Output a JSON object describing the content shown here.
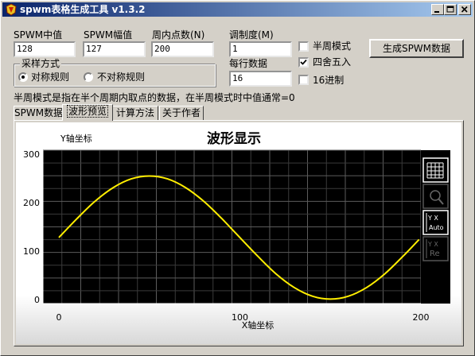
{
  "window": {
    "title": "spwm表格生成工具 v1.3.2"
  },
  "fields": {
    "center_label": "SPWM中值",
    "center_value": "128",
    "amp_label": "SPWM幅值",
    "amp_value": "127",
    "points_label": "周内点数(N)",
    "points_value": "200",
    "mod_label": "调制度(M)",
    "mod_value": "1",
    "perline_label": "每行数据",
    "perline_value": "16"
  },
  "options": {
    "half_cycle": {
      "label": "半周模式",
      "checked": false
    },
    "round": {
      "label": "四舍五入",
      "checked": true
    },
    "hex": {
      "label": "16进制",
      "checked": false
    }
  },
  "sampling": {
    "title": "采样方式",
    "symmetric": {
      "label": "对称规则",
      "selected": true
    },
    "asymmetric": {
      "label": "不对称规则",
      "selected": false
    }
  },
  "generate_button": "生成SPWM数据",
  "note": "半周模式是指在半个周期内取点的数据，在半周模式时中值通常=0",
  "tabs": [
    {
      "label": "SPWM数据",
      "active": false
    },
    {
      "label": "波形预览",
      "active": true
    },
    {
      "label": "计算方法",
      "active": false
    },
    {
      "label": "关于作者",
      "active": false
    }
  ],
  "chart_data": {
    "type": "line",
    "title": "波形显示",
    "xlabel": "X轴坐标",
    "ylabel": "Y轴坐标",
    "xlim": [
      0,
      200
    ],
    "ylim": [
      0,
      300
    ],
    "x_ticks": [
      "0",
      "100",
      "200"
    ],
    "y_ticks": [
      "0",
      "100",
      "200",
      "300"
    ],
    "grid": true,
    "background": "#000000",
    "line_color": "#ffee00",
    "series": [
      {
        "x": [
          0,
          10,
          20,
          30,
          40,
          50,
          60,
          70,
          80,
          90,
          100,
          110,
          120,
          130,
          140,
          150,
          160,
          170,
          180,
          190,
          199
        ],
        "values": [
          128,
          167,
          203,
          231,
          249,
          255,
          249,
          231,
          203,
          167,
          128,
          89,
          53,
          25,
          7,
          1,
          7,
          25,
          53,
          89,
          124
        ]
      }
    ],
    "toolbar_icons": [
      "grid-icon",
      "zoom-icon",
      "y-auto-icon",
      "y-reset-icon"
    ],
    "toolbar_labels": {
      "y_auto_top": "Y  X",
      "y_auto_bottom": "Auto",
      "y_reset_top": "Y  X",
      "y_reset_bottom": "Re"
    }
  }
}
